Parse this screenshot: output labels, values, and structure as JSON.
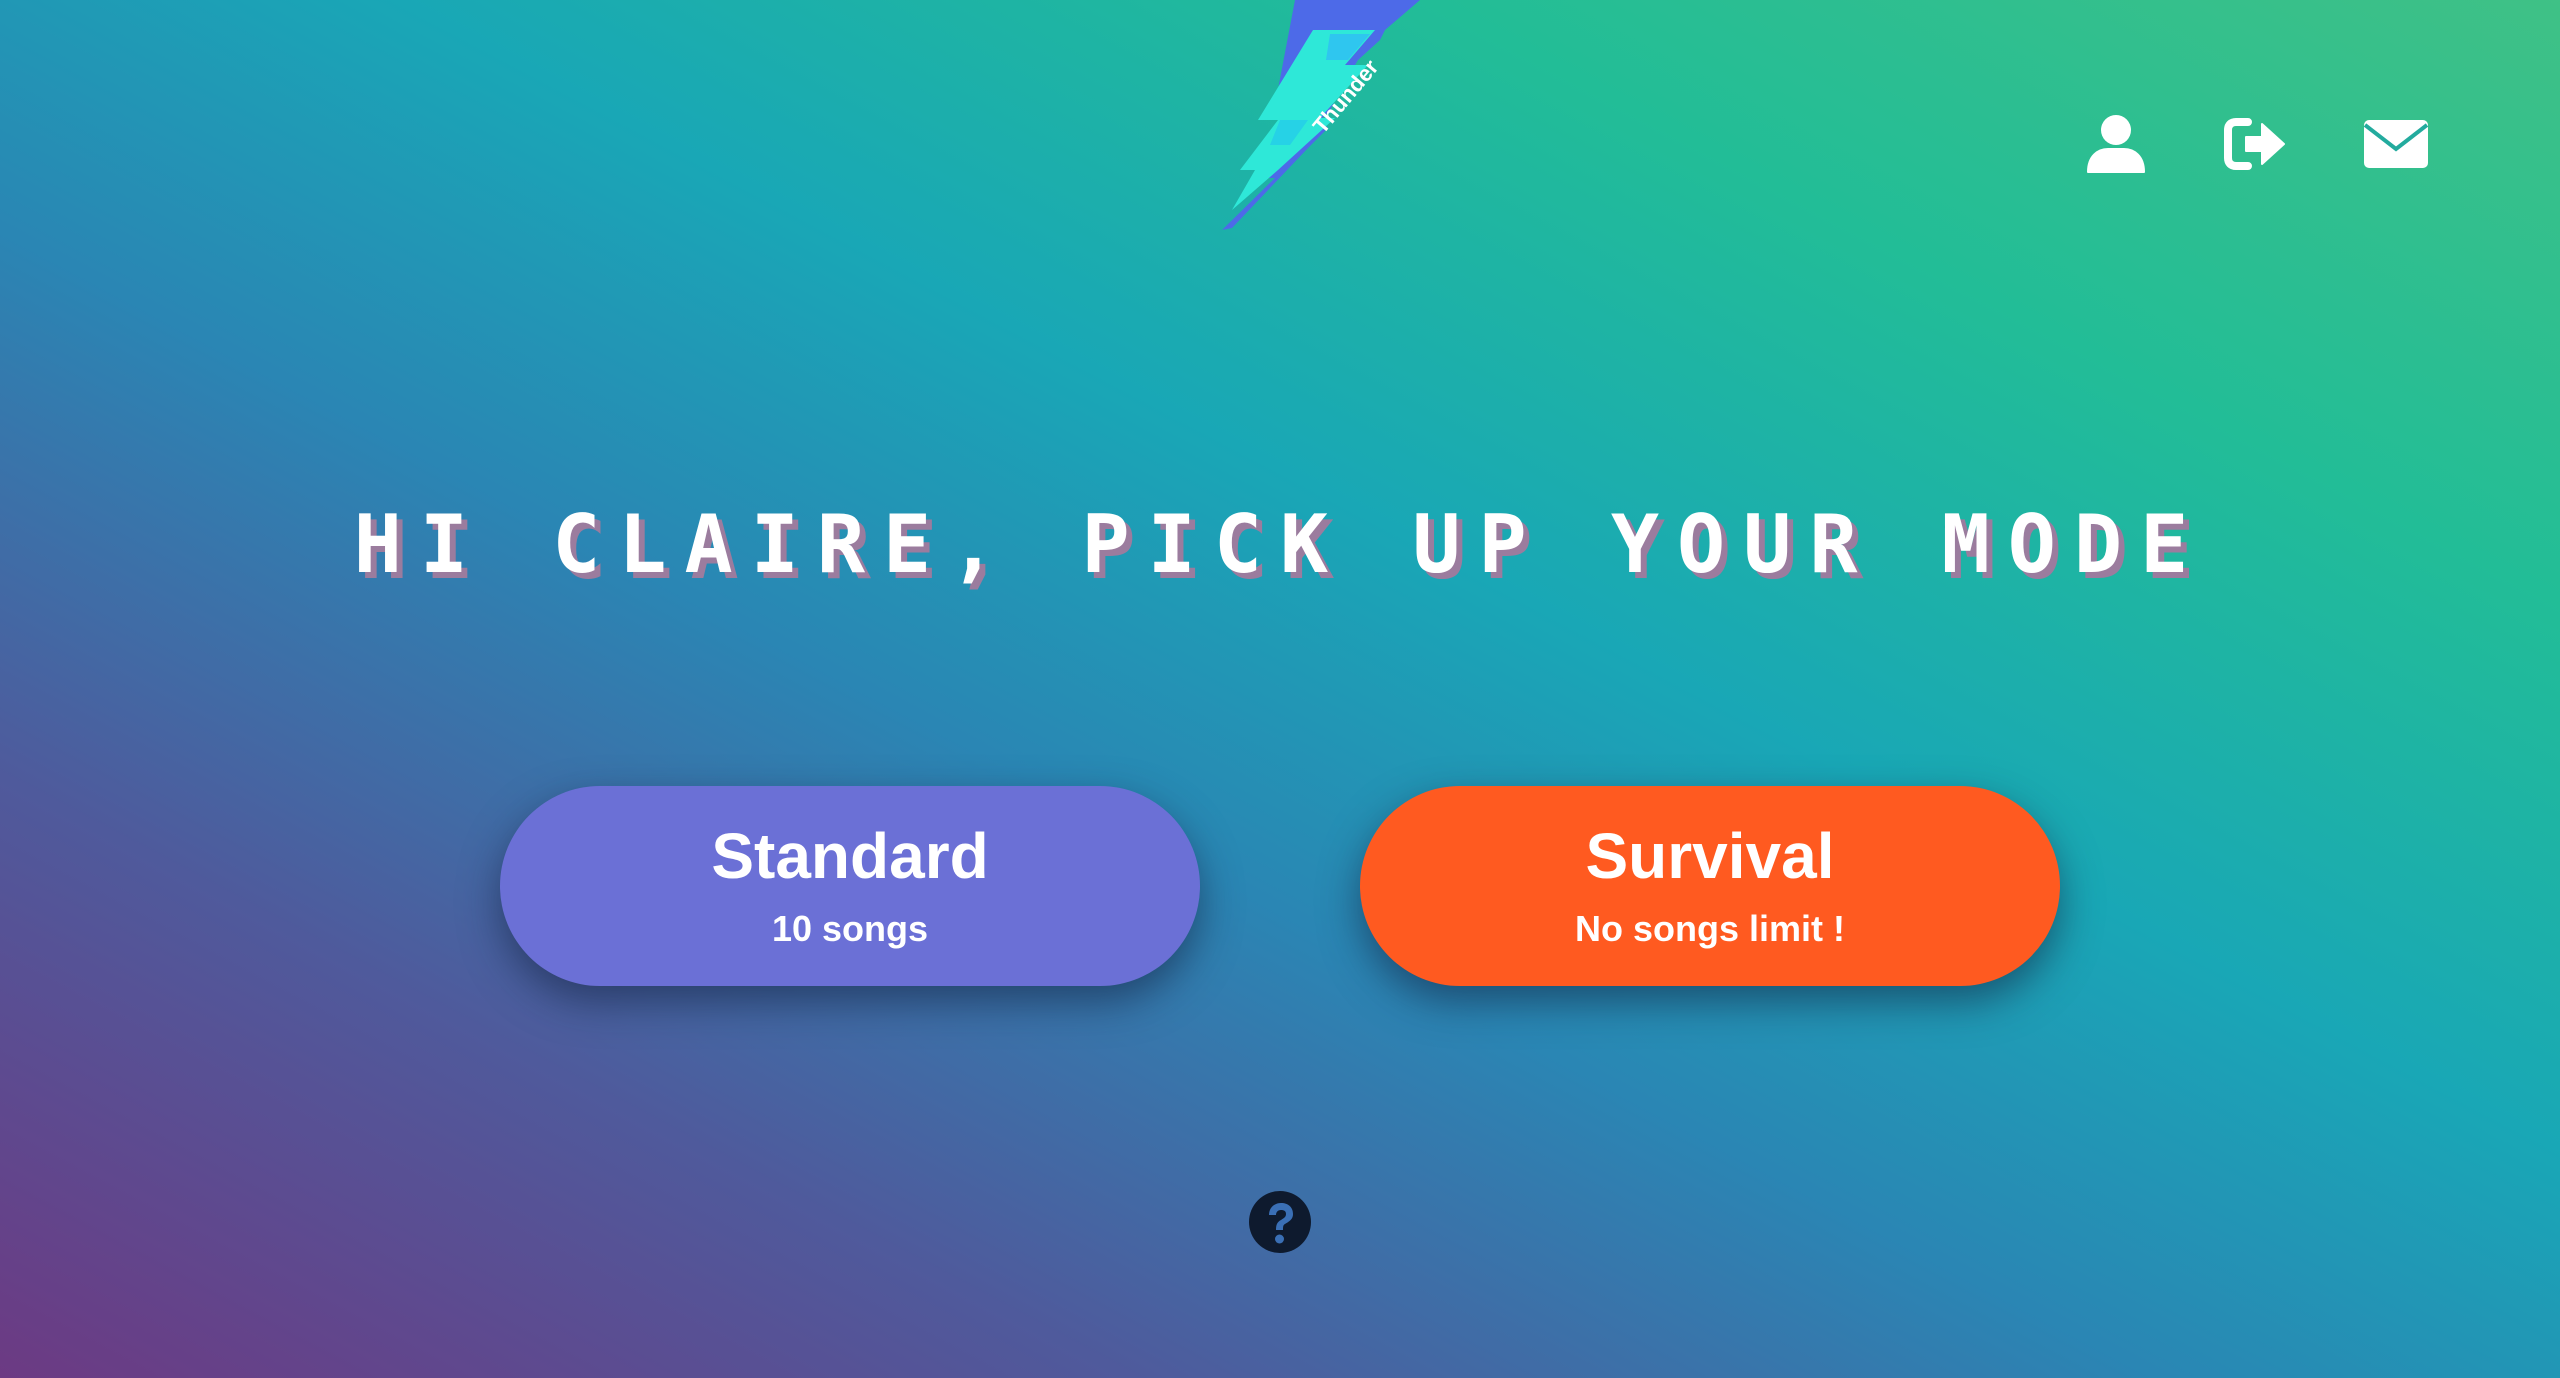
{
  "logo": {
    "text": "Thunder",
    "icon": "lightning-bolt-logo"
  },
  "header_icons": [
    {
      "name": "user-icon"
    },
    {
      "name": "logout-icon"
    },
    {
      "name": "mail-icon"
    }
  ],
  "headline": "HI CLAIRE, PICK UP YOUR MODE",
  "modes": {
    "standard": {
      "title": "Standard",
      "subtitle": "10 songs",
      "color": "#6b70d6"
    },
    "survival": {
      "title": "Survival",
      "subtitle": "No songs limit !",
      "color": "#ff5a20"
    }
  },
  "help": {
    "icon": "question-circle-icon"
  }
}
